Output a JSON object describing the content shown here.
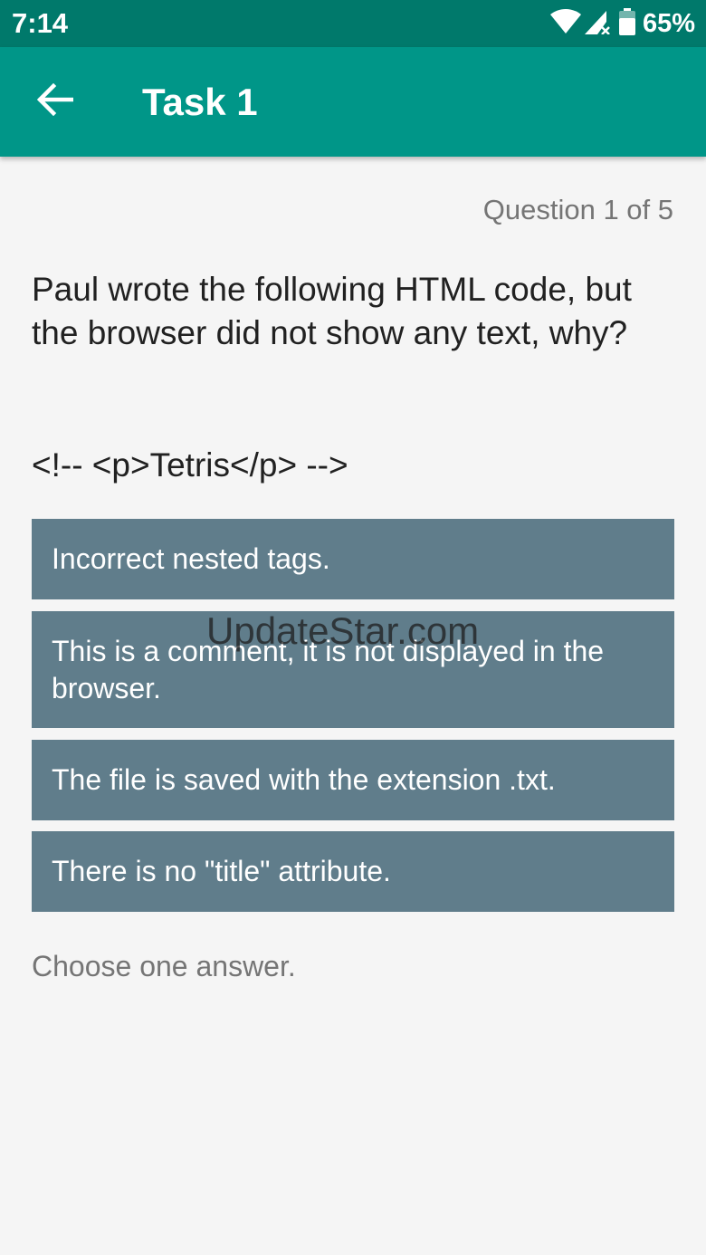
{
  "status_bar": {
    "time": "7:14",
    "battery": "65%",
    "icons": [
      "wifi-icon",
      "signal-icon",
      "battery-icon"
    ]
  },
  "app_bar": {
    "title": "Task 1",
    "back_icon": "arrow-back-icon",
    "color": "#009688"
  },
  "quiz": {
    "progress": "Question 1 of 5",
    "question": "Paul wrote the following HTML code, but the browser did not show any text, why?",
    "code": "<!-- <p>Tetris</p> -->",
    "answers": [
      {
        "label": "Incorrect nested tags."
      },
      {
        "label": "This is a comment, it is not displayed in the browser."
      },
      {
        "label": "The file is saved with the extension .txt."
      },
      {
        "label": "There is no \"title\" attribute."
      }
    ],
    "hint": "Choose one answer.",
    "answer_color": "#607d8b"
  },
  "watermark": "UpdateStar.com",
  "colors": {
    "status_bar": "#00796b",
    "background": "#f5f5f5"
  }
}
